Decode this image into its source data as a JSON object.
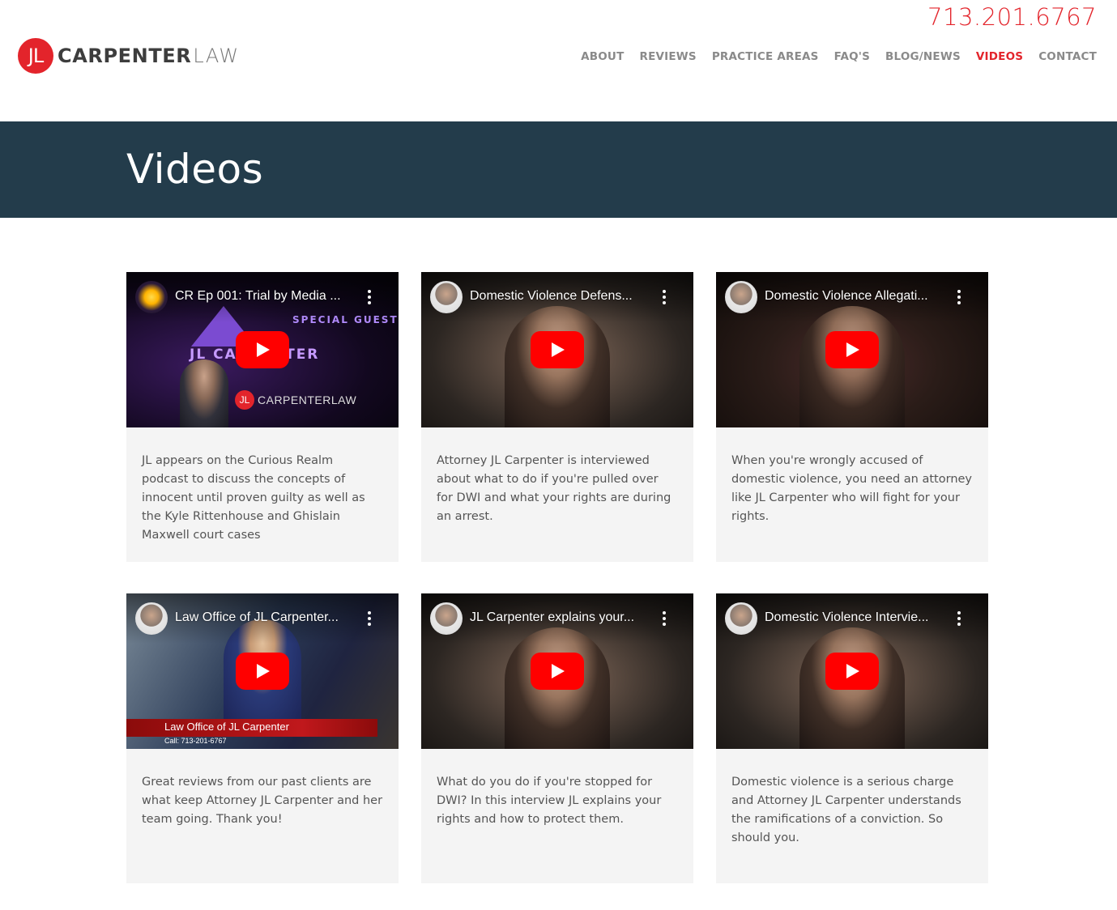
{
  "header": {
    "phone": "713.201.6767",
    "logo": {
      "mark": "JL",
      "word1": "CARPENTER",
      "word2": "LAW"
    },
    "nav": [
      {
        "label": "ABOUT",
        "active": false
      },
      {
        "label": "REVIEWS",
        "active": false
      },
      {
        "label": "PRACTICE AREAS",
        "active": false
      },
      {
        "label": "FAQ'S",
        "active": false
      },
      {
        "label": "BLOG/NEWS",
        "active": false
      },
      {
        "label": "VIDEOS",
        "active": true
      },
      {
        "label": "CONTACT",
        "active": false
      }
    ]
  },
  "banner": {
    "title": "Videos"
  },
  "videos": [
    {
      "title": "CR Ep 001: Trial by Media ...",
      "description": "JL appears on the Curious Realm podcast to discuss the concepts of innocent until proven guilty as well as the Kyle Rittenhouse and Ghislain Maxwell court cases",
      "overlay": {
        "special_guest": "SPECIAL GUEST",
        "name": "JL CARPENTER",
        "brand_mark": "JL",
        "brand_word": "CARPENTERLAW"
      }
    },
    {
      "title": "Domestic Violence Defens...",
      "description": "Attorney JL Carpenter is interviewed about what to do if you're pulled over for DWI and what your rights are during an arrest."
    },
    {
      "title": "Domestic Violence Allegati...",
      "description": "When you're wrongly accused of domestic violence, you need an attorney like JL Carpenter who will fight for your rights."
    },
    {
      "title": "Law Office of JL Carpenter...",
      "description": "Great reviews from our past clients are what keep Attorney JL Carpenter and her team going. Thank you!",
      "overlay": {
        "lower_third_name": "Law Office of JL Carpenter",
        "lower_third_call": "Call: 713-201-6767"
      }
    },
    {
      "title": "JL Carpenter explains your...",
      "description": "What do you do if you're stopped for DWI? In this interview JL explains your rights and how to protect them."
    },
    {
      "title": "Domestic Violence Intervie...",
      "description": "Domestic violence is a serious charge and Attorney JL Carpenter understands the ramifications of a conviction. So should you."
    }
  ],
  "colors": {
    "accent": "#e3242b",
    "banner": "#233c4b",
    "card": "#f4f4f4",
    "youtube_red": "#ff0000"
  }
}
